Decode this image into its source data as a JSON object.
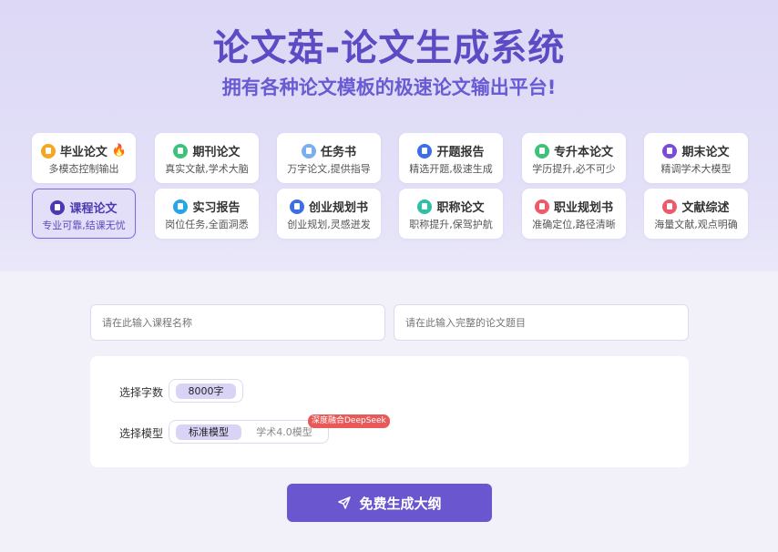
{
  "header": {
    "title": "论文菇-论文生成系统",
    "subtitle": "拥有各种论文模板的极速论文输出平台!"
  },
  "cards": [
    {
      "name": "毕业论文",
      "desc": "多模态控制输出",
      "icon": "doc-icon",
      "color": "#f5a623",
      "hot": true,
      "active": false
    },
    {
      "name": "期刊论文",
      "desc": "真实文献,学术大脑",
      "icon": "journal-icon",
      "color": "#3cc27a",
      "active": false
    },
    {
      "name": "任务书",
      "desc": "万字论文,提供指导",
      "icon": "task-icon",
      "color": "#7aaef0",
      "active": false
    },
    {
      "name": "开题报告",
      "desc": "精选开题,极速生成",
      "icon": "report-icon",
      "color": "#3d6ee8",
      "active": false
    },
    {
      "name": "专升本论文",
      "desc": "学历提升,必不可少",
      "icon": "book-icon",
      "color": "#3cc27a",
      "active": false
    },
    {
      "name": "期末论文",
      "desc": "精调学术大模型",
      "icon": "paper-icon",
      "color": "#7a4bd6",
      "active": false
    },
    {
      "name": "课程论文",
      "desc": "专业可靠,结课无忧",
      "icon": "course-icon",
      "color": "#4a3ab0",
      "active": true
    },
    {
      "name": "实习报告",
      "desc": "岗位任务,全面洞悉",
      "icon": "intern-icon",
      "color": "#26a6e6",
      "active": false
    },
    {
      "name": "创业规划书",
      "desc": "创业规划,灵感迸发",
      "icon": "startup-icon",
      "color": "#3d6ee8",
      "active": false
    },
    {
      "name": "职称论文",
      "desc": "职称提升,保驾护航",
      "icon": "title-icon",
      "color": "#2fbfa6",
      "active": false
    },
    {
      "name": "职业规划书",
      "desc": "准确定位,路径清晰",
      "icon": "career-icon",
      "color": "#ef5a6a",
      "active": false
    },
    {
      "name": "文献综述",
      "desc": "海量文献,观点明确",
      "icon": "literature-icon",
      "color": "#ef5a6a",
      "active": false
    }
  ],
  "form": {
    "course_placeholder": "请在此输入课程名称",
    "topic_placeholder": "请在此输入完整的论文题目",
    "word_count_label": "选择字数",
    "word_count_value": "8000字",
    "model_label": "选择模型",
    "model_options": [
      "标准模型",
      "学术4.0模型"
    ],
    "model_selected": "标准模型",
    "model_badge": "深度融合DeepSeek"
  },
  "actions": {
    "generate_label": "免费生成大纲"
  }
}
